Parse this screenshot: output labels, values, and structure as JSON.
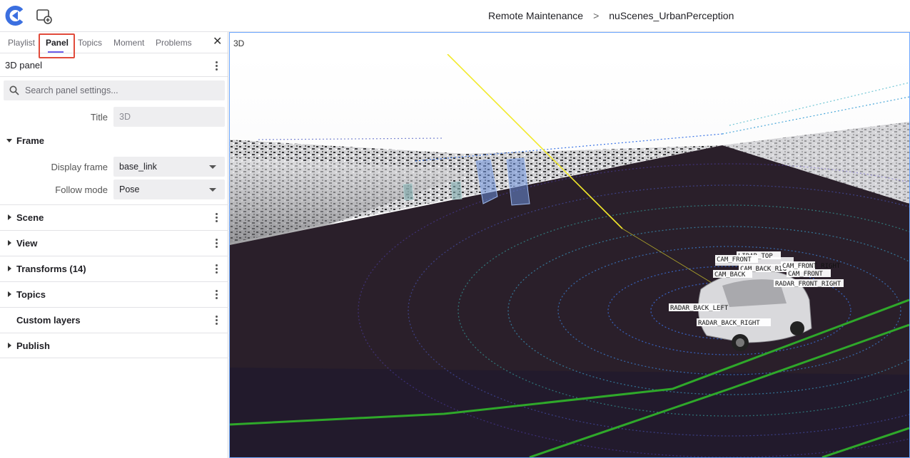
{
  "topbar": {
    "breadcrumb": [
      "Remote Maintenance",
      "nuScenes_UrbanPerception"
    ],
    "separator": ">"
  },
  "sidebar": {
    "tabs": [
      "Playlist",
      "Panel",
      "Topics",
      "Moment",
      "Problems"
    ],
    "active_tab": "Panel",
    "close_symbol": "✕",
    "panel_title": "3D panel",
    "search_placeholder": "Search panel settings...",
    "title_label": "Title",
    "title_value": "3D",
    "frame_section": "Frame",
    "display_frame_label": "Display frame",
    "display_frame_value": "base_link",
    "follow_mode_label": "Follow mode",
    "follow_mode_value": "Pose",
    "sections": [
      "Scene",
      "View",
      "Transforms (14)",
      "Topics",
      "Custom layers",
      "Publish"
    ]
  },
  "viewport": {
    "title": "3D",
    "frame_labels": [
      "LIDAR_TOP",
      "CAM_FRONT",
      "CAM_BACK_RIGHT",
      "CAM_FRONT_RIGHT",
      "CAM_BACK",
      "CAM_FRONT",
      "RADAR_FRONT_RIGHT",
      "RADAR_BACK_LEFT",
      "RADAR_BACK_RIGHT"
    ]
  },
  "colors": {
    "accent": "#6c5ce7",
    "highlight_box": "#e14b3b",
    "lane_lines": "#2fa82a",
    "ray": "#f2e92a",
    "ground": "#2a1f2a"
  },
  "icons": [
    "app-logo-icon",
    "add-panel-icon",
    "search-icon",
    "close-icon",
    "kebab-menu-icon",
    "caret-down-icon",
    "chevron-right-icon"
  ]
}
